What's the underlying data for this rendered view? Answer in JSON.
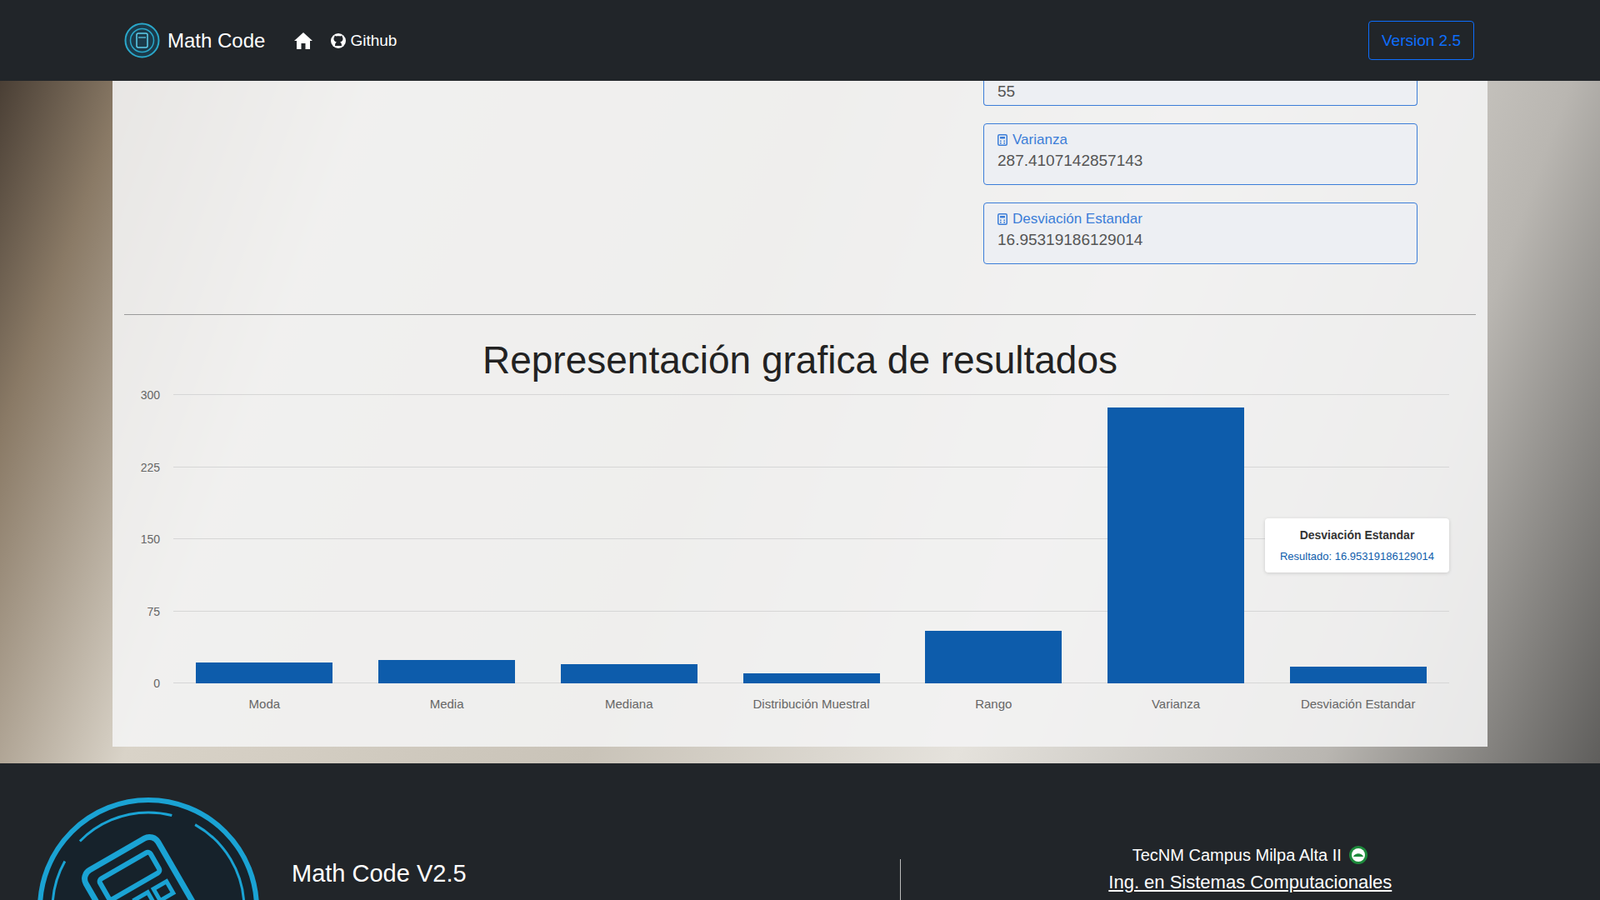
{
  "navbar": {
    "brand": "Math Code",
    "links": [
      "Github"
    ],
    "version_button": "Version 2.5"
  },
  "results": {
    "partial_field": {
      "value": "55"
    },
    "fields": [
      {
        "label": "Varianza",
        "value": "287.4107142857143"
      },
      {
        "label": "Desviación Estandar",
        "value": "16.95319186129014"
      }
    ]
  },
  "chart": {
    "title": "Representación grafica de resultados",
    "y_ticks": [
      "0",
      "75",
      "150",
      "225",
      "300"
    ],
    "categories": [
      "Moda",
      "Media",
      "Mediana",
      "Distribución Muestral",
      "Rango",
      "Varianza",
      "Desviación Estandar"
    ],
    "series": [
      {
        "name": "Resultado",
        "values": [
          22,
          24,
          20,
          10,
          55,
          287.4107142857143,
          16.95319186129014
        ]
      }
    ],
    "tooltip": {
      "title": "Desviación Estandar",
      "text": "Resultado: 16.95319186129014"
    }
  },
  "footer": {
    "title": "Math Code V2.5",
    "campus": "TecNM Campus Milpa Alta II",
    "career": "Ing. en Sistemas Computacionales"
  }
}
